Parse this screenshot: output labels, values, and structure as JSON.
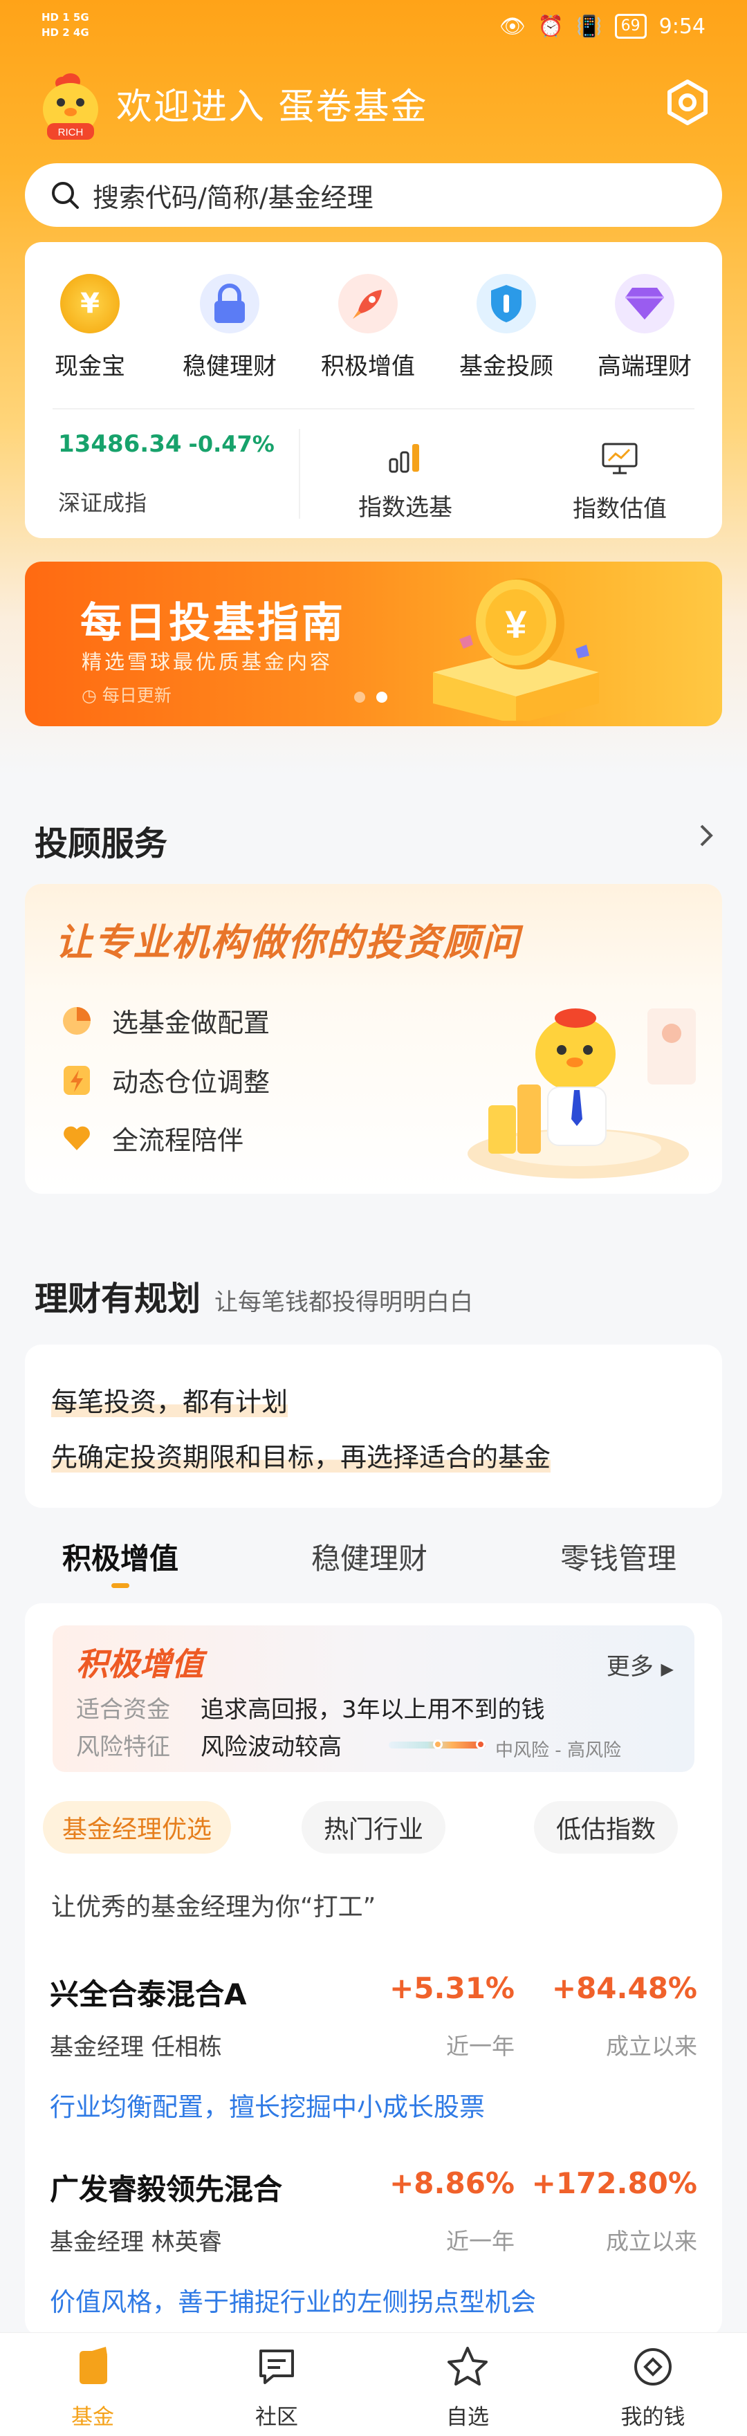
{
  "status_bar": {
    "left_lines": [
      "HD 1  5G",
      "HD 2  4G"
    ],
    "battery": "69",
    "time": "9:54"
  },
  "header": {
    "welcome": "欢迎进入 蛋卷基金",
    "mascot_badge": "RICH",
    "settings_icon": "gear-icon"
  },
  "search": {
    "placeholder": "搜索代码/简称/基金经理"
  },
  "quick_menu": {
    "items": [
      {
        "label": "现金宝",
        "icon": "coin-icon",
        "color": "#f7b21c"
      },
      {
        "label": "稳健理财",
        "icon": "lock-icon",
        "color": "#5b7cf5"
      },
      {
        "label": "积极增值",
        "icon": "rocket-icon",
        "color": "#f2553e"
      },
      {
        "label": "基金投顾",
        "icon": "shield-icon",
        "color": "#2b9ae8"
      },
      {
        "label": "高端理财",
        "icon": "diamond-icon",
        "color": "#9a5cf0"
      }
    ],
    "index": {
      "value": "13486.34",
      "change": "-0.47%",
      "name": "深证成指"
    },
    "tools": [
      {
        "label": "指数选基",
        "icon": "bar-chart-icon"
      },
      {
        "label": "指数估值",
        "icon": "monitor-chart-icon"
      }
    ]
  },
  "banner": {
    "title": "每日投基指南",
    "subtitle": "精选雪球最优质基金内容",
    "note": "每日更新",
    "dots": 2,
    "active_dot": 1
  },
  "advisor_section": {
    "title": "投顾服务",
    "card_title": "让专业机构做你的投资顾问",
    "items": [
      {
        "label": "选基金做配置",
        "icon": "pie-chart-icon"
      },
      {
        "label": "动态仓位调整",
        "icon": "lightning-icon"
      },
      {
        "label": "全流程陪伴",
        "icon": "heart-icon"
      }
    ]
  },
  "plan_section": {
    "title": "理财有规划",
    "subtitle": "让每笔钱都投得明明白白",
    "line1": "每笔投资，都有计划",
    "line2": "先确定投资期限和目标，再选择适合的基金"
  },
  "tabs": {
    "items": [
      "积极增值",
      "稳健理财",
      "零钱管理"
    ],
    "active": 0
  },
  "category": {
    "title": "积极增值",
    "more": "更多",
    "fund_label": "适合资金",
    "fund_value": "追求高回报，3年以上用不到的钱",
    "risk_label": "风险特征",
    "risk_value": "风险波动较高",
    "risk_range_from": "中风险",
    "risk_range_sep": "-",
    "risk_range_to": "高风险"
  },
  "chips": {
    "items": [
      "基金经理优选",
      "热门行业",
      "低估指数"
    ],
    "active": 0
  },
  "slogan": "让优秀的基金经理为你“打工”",
  "funds": [
    {
      "name": "兴全合泰混合A",
      "manager": "基金经理 任相栋",
      "return_1y": "+5.31%",
      "period_1y": "近一年",
      "return_total": "+84.48%",
      "period_total": "成立以来",
      "desc": "行业均衡配置，擅长挖掘中小成长股票"
    },
    {
      "name": "广发睿毅领先混合",
      "manager": "基金经理 林英睿",
      "return_1y": "+8.86%",
      "period_1y": "近一年",
      "return_total": "+172.80%",
      "period_total": "成立以来",
      "desc": "价值风格，善于捕捉行业的左侧拐点型机会"
    }
  ],
  "bottom_nav": {
    "items": [
      {
        "label": "基金",
        "icon": "fund-home-icon"
      },
      {
        "label": "社区",
        "icon": "message-icon"
      },
      {
        "label": "自选",
        "icon": "star-icon"
      },
      {
        "label": "我的钱",
        "icon": "wallet-icon"
      }
    ],
    "active": 0,
    "active_color": "#f5a21a"
  }
}
